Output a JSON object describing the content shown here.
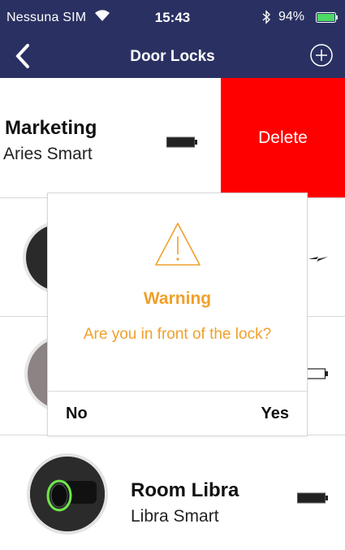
{
  "status_bar": {
    "carrier": "Nessuna SIM",
    "time": "15:43",
    "battery_percent": "94%",
    "icons": [
      "wifi-icon",
      "bluetooth-icon",
      "battery-icon",
      "charging-icon"
    ]
  },
  "nav": {
    "title": "Door Locks",
    "back_icon": "chevron-left-icon",
    "add_icon": "plus-circle-icon"
  },
  "locks": [
    {
      "name": "Marketing",
      "model": "Aries Smart",
      "battery_level": 1.0
    },
    {
      "name": "",
      "model": ""
    },
    {
      "name": "",
      "model": ""
    },
    {
      "name": "Room Libra",
      "model": "Libra Smart",
      "battery_level": 1.0
    }
  ],
  "row_actions": {
    "delete_label": "Delete"
  },
  "dialog": {
    "icon": "warning-triangle-icon",
    "title": "Warning",
    "message": "Are you in front of the lock?",
    "no_label": "No",
    "yes_label": "Yes"
  },
  "colors": {
    "header": "#2a3162",
    "delete": "#ff0000",
    "warning": "#f0a02b"
  }
}
